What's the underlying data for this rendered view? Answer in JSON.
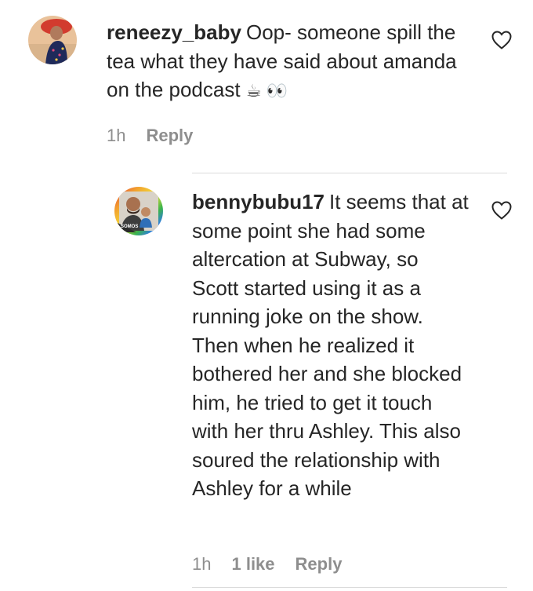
{
  "comments": [
    {
      "username": "reneezy_baby",
      "text": "Oop- someone spill the tea what they have said about amanda on the podcast",
      "emoji": "☕ 👀",
      "time": "1h",
      "reply_label": "Reply"
    },
    {
      "username": "bennybubu17",
      "text": "It seems that at some point she had some altercation at Subway, so Scott started using it as a running joke on the show. Then when he realized it bothered her and she blocked him, he tried to get it touch with her thru Ashley. This also soured the relationship with Ashley for a while",
      "avatar_badge": "SOMOS",
      "time": "1h",
      "likes": "1 like",
      "reply_label": "Reply"
    }
  ],
  "colors": {
    "text": "#262626",
    "meta": "#8e8e8e",
    "divider": "#dbdbdb"
  }
}
